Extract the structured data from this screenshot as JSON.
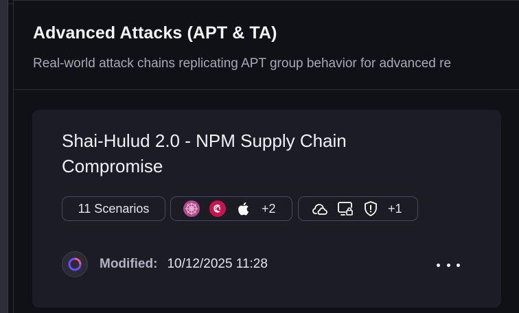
{
  "header": {
    "title": "Advanced Attacks (APT & TA)",
    "subtitle": "Real-world attack chains replicating APT group behavior for advanced re"
  },
  "card": {
    "title": "Shai-Hulud 2.0 - NPM Supply Chain Compromise",
    "scenarios_label": "11 Scenarios",
    "platforms": {
      "icons": [
        "redhat-flower-icon",
        "debian-icon",
        "apple-icon"
      ],
      "more_count": "+2"
    },
    "tactics": {
      "icons": [
        "cloud-icon",
        "endpoint-lock-icon",
        "shield-alert-icon"
      ],
      "more_count": "+1"
    },
    "modified_label": "Modified:",
    "modified_value": "10/12/2025 11:28"
  },
  "colors": {
    "background": "#101117",
    "card": "#1c1d24",
    "chip_border": "#484a55",
    "platform_pink": "#b14a8e",
    "debian_red": "#c7144f",
    "avatar_purple": "#6f4cff"
  }
}
